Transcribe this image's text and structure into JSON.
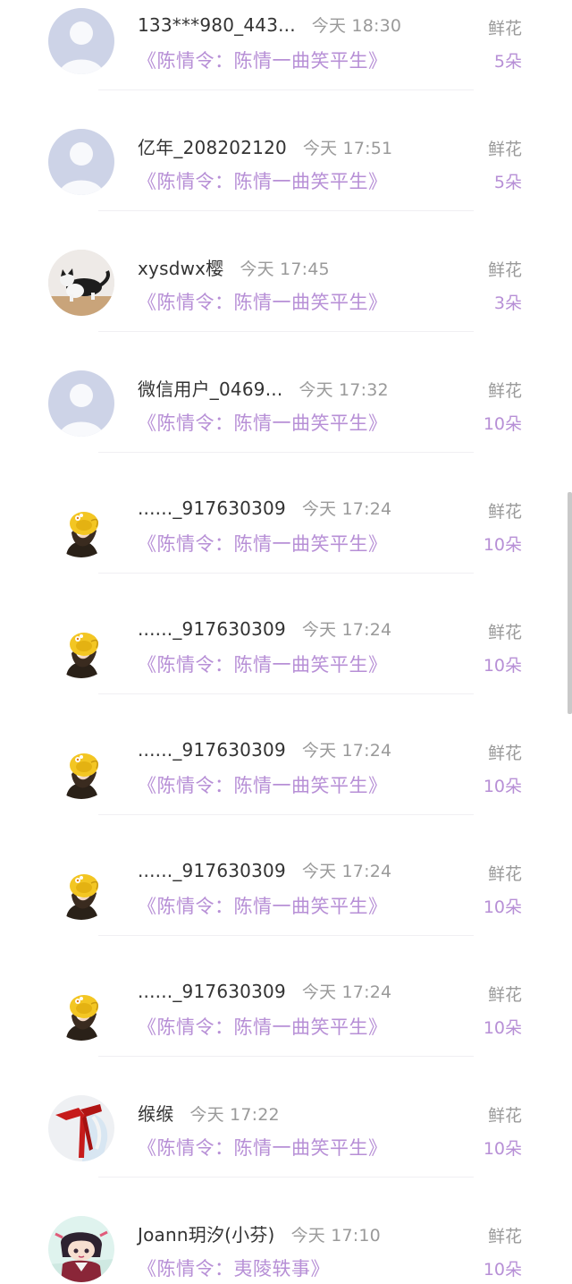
{
  "records": [
    {
      "name": "133***980_443...",
      "time": "今天 18:30",
      "book": "《陈情令：陈情一曲笑平生》",
      "gift_type": "鲜花",
      "gift_count": "5朵",
      "avatar": "default-avatar-icon"
    },
    {
      "name": "亿年_208202120",
      "time": "今天 17:51",
      "book": "《陈情令：陈情一曲笑平生》",
      "gift_type": "鲜花",
      "gift_count": "5朵",
      "avatar": "default-avatar-icon"
    },
    {
      "name": "xysdwx樱",
      "time": "今天 17:45",
      "book": "《陈情令：陈情一曲笑平生》",
      "gift_type": "鲜花",
      "gift_count": "3朵",
      "avatar": "cat-avatar-icon"
    },
    {
      "name": "微信用户_0469...",
      "time": "今天 17:32",
      "book": "《陈情令：陈情一曲笑平生》",
      "gift_type": "鲜花",
      "gift_count": "10朵",
      "avatar": "default-avatar-icon"
    },
    {
      "name": "......_917630309",
      "time": "今天 17:24",
      "book": "《陈情令：陈情一曲笑平生》",
      "gift_type": "鲜花",
      "gift_count": "10朵",
      "avatar": "yellow-hat-girl-avatar-icon"
    },
    {
      "name": "......_917630309",
      "time": "今天 17:24",
      "book": "《陈情令：陈情一曲笑平生》",
      "gift_type": "鲜花",
      "gift_count": "10朵",
      "avatar": "yellow-hat-girl-avatar-icon"
    },
    {
      "name": "......_917630309",
      "time": "今天 17:24",
      "book": "《陈情令：陈情一曲笑平生》",
      "gift_type": "鲜花",
      "gift_count": "10朵",
      "avatar": "yellow-hat-girl-avatar-icon"
    },
    {
      "name": "......_917630309",
      "time": "今天 17:24",
      "book": "《陈情令：陈情一曲笑平生》",
      "gift_type": "鲜花",
      "gift_count": "10朵",
      "avatar": "yellow-hat-girl-avatar-icon"
    },
    {
      "name": "......_917630309",
      "time": "今天 17:24",
      "book": "《陈情令：陈情一曲笑平生》",
      "gift_type": "鲜花",
      "gift_count": "10朵",
      "avatar": "yellow-hat-girl-avatar-icon"
    },
    {
      "name": "缑缑",
      "time": "今天 17:22",
      "book": "《陈情令：陈情一曲笑平生》",
      "gift_type": "鲜花",
      "gift_count": "10朵",
      "avatar": "red-ribbon-avatar-icon"
    },
    {
      "name": "Joann玥汐(小芬)",
      "time": "今天 17:10",
      "book": "《陈情令：夷陵轶事》",
      "gift_type": "鲜花",
      "gift_count": "10朵",
      "avatar": "anime-character-avatar-icon"
    }
  ],
  "colors": {
    "accent_purple": "#b78fd6",
    "muted_gray": "#9a9a9a",
    "name_text": "#333333",
    "default_avatar_bg": "#cdd3e7"
  }
}
